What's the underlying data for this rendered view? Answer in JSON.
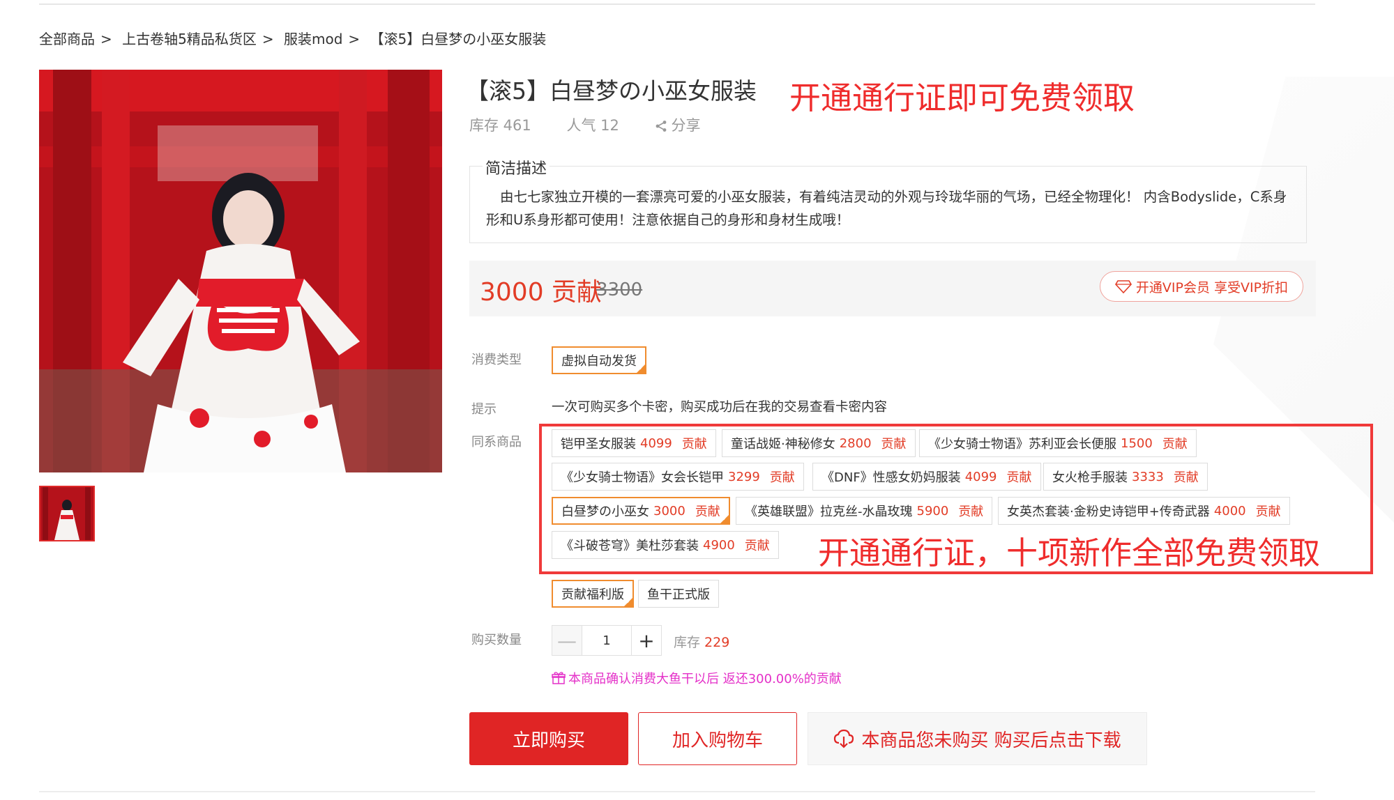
{
  "breadcrumb": [
    "全部商品",
    "上古卷轴5精品私货区",
    "服装mod",
    "【滚5】白昼梦の小巫女服装"
  ],
  "product": {
    "title": "【滚5】白昼梦の小巫女服装",
    "promo_text": "开通通行证即可免费领取",
    "stock": "库存 461",
    "popularity": "人气 12",
    "share": "分享"
  },
  "description": {
    "legend": "简洁描述",
    "text": "由七七家独立开模的一套漂亮可爱的小巫女服装，有着纯洁灵动的外观与玲珑华丽的气场，已经全物理化！ 内含Bodyslide，C系身形和U系身形都可使用！注意依据自己的身形和身材生成哦！"
  },
  "price": {
    "current": "3000 贡献",
    "original": "3300",
    "vip_label": "开通VIP会员 享受VIP折扣"
  },
  "consume_type": {
    "label": "消费类型",
    "option": "虚拟自动发货"
  },
  "hint": {
    "label": "提示",
    "text": "一次可购买多个卡密，购买成功后在我的交易查看卡密内容"
  },
  "series": {
    "label": "同系商品",
    "items": [
      {
        "name": "铠甲圣女服装",
        "price": "4099",
        "unit": "贡献"
      },
      {
        "name": "童话战姬·神秘修女",
        "price": "2800",
        "unit": "贡献"
      },
      {
        "name": "《少女骑士物语》苏利亚会长便服",
        "price": "1500",
        "unit": "贡献"
      },
      {
        "name": "《少女骑士物语》女会长铠甲",
        "price": "3299",
        "unit": "贡献"
      },
      {
        "name": "《DNF》性感女奶妈服装",
        "price": "4099",
        "unit": "贡献"
      },
      {
        "name": "女火枪手服装",
        "price": "3333",
        "unit": "贡献"
      },
      {
        "name": "白昼梦の小巫女",
        "price": "3000",
        "unit": "贡献"
      },
      {
        "name": "《英雄联盟》拉克丝-水晶玫瑰",
        "price": "5900",
        "unit": "贡献"
      },
      {
        "name": "女英杰套装·金粉史诗铠甲+传奇武器",
        "price": "4000",
        "unit": "贡献"
      },
      {
        "name": "《斗破苍穹》美杜莎套装",
        "price": "4900",
        "unit": "贡献"
      }
    ],
    "promo_text": "开通通行证，十项新作全部免费领取"
  },
  "versions": [
    "贡献福利版",
    "鱼干正式版"
  ],
  "quantity": {
    "label": "购买数量",
    "value": "1",
    "stock_label": "库存",
    "stock_value": "229"
  },
  "rebate_text": "本商品确认消费大鱼干以后 返还300.00%的贡献",
  "buttons": {
    "buy": "立即购买",
    "cart": "加入购物车",
    "download": "本商品您未购买 购买后点击下载"
  },
  "colors": {
    "accent_red": "#e02525",
    "promo_red": "#ef2c2c",
    "selected_orange": "#f08c2e",
    "rebate_magenta": "#e430c8"
  }
}
